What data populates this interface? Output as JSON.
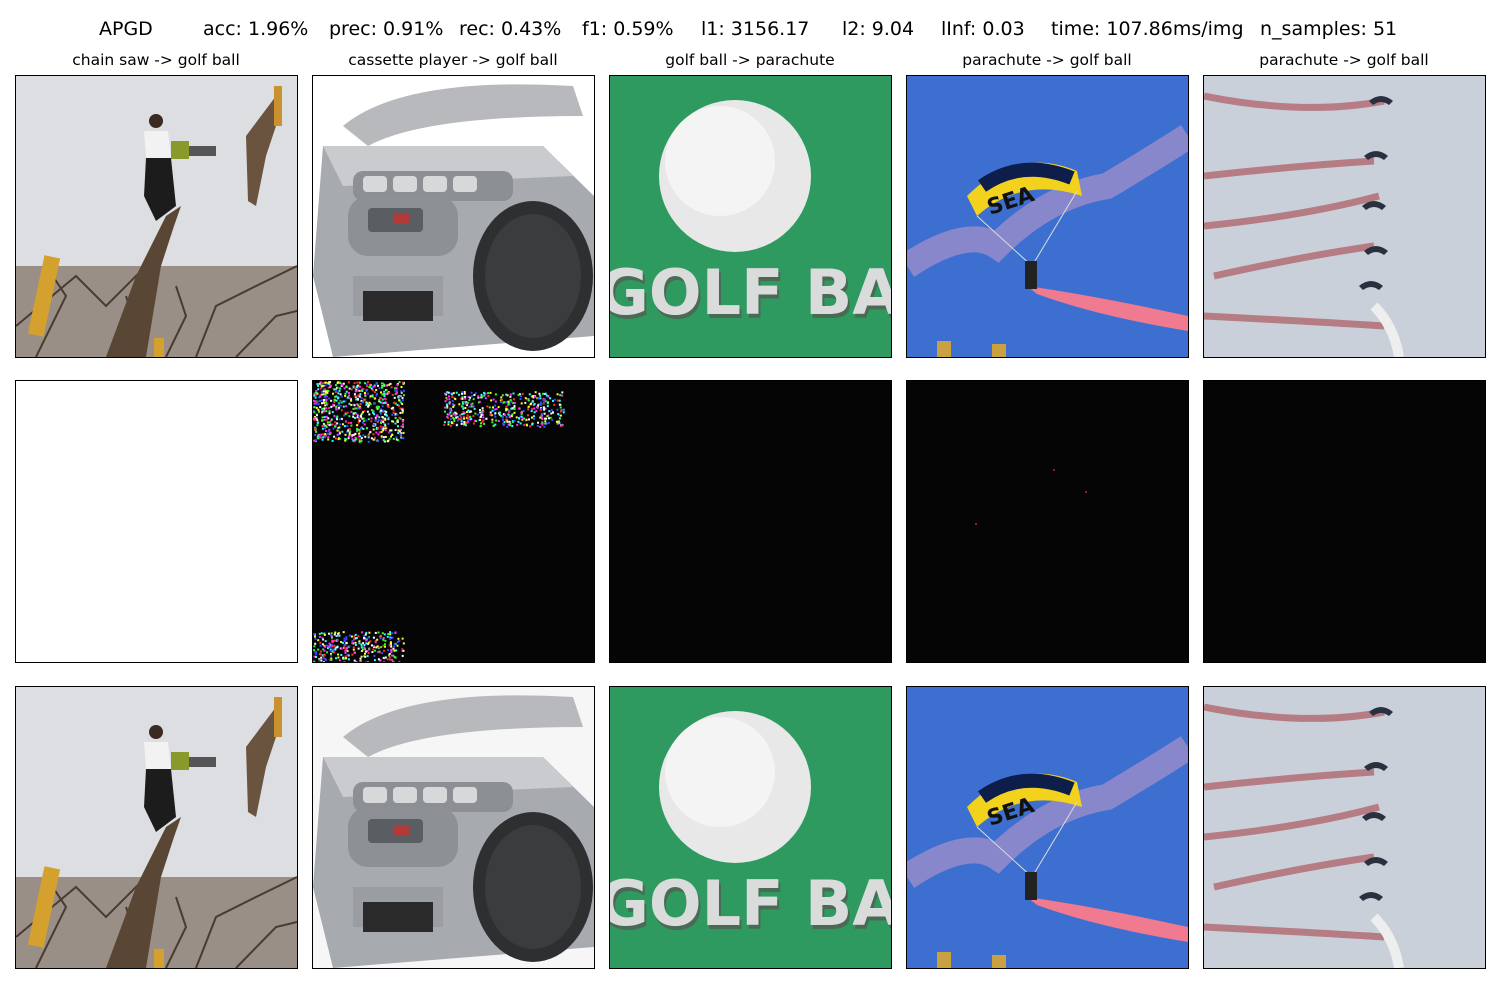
{
  "header": {
    "method": "APGD",
    "acc": "acc: 1.96%",
    "prec": "prec: 0.91%",
    "rec": "rec: 0.43%",
    "f1": "f1: 0.59%",
    "l1": "l1: 3156.17",
    "l2": "l2: 9.04",
    "linf": "lInf: 0.03",
    "time": "time: 107.86ms/img",
    "n_samples": "n_samples: 51"
  },
  "columns": [
    {
      "title": "chain saw -> golf ball"
    },
    {
      "title": "cassette player -> golf ball"
    },
    {
      "title": "golf ball -> parachute"
    },
    {
      "title": "parachute -> golf ball"
    },
    {
      "title": "parachute -> golf ball"
    }
  ],
  "images": {
    "golf_text": "GOLF BALL",
    "parachute_text": "SEA"
  },
  "colors": {
    "sky": "#dfe1e4",
    "golf_green": "#2e9a60",
    "parachute_sky": "#3d6fd0",
    "canopy_yellow": "#f2d21c",
    "smoke_pink": "#f07a90",
    "smoke_red": "#b04a50",
    "perturbation_bg": "#050505"
  }
}
